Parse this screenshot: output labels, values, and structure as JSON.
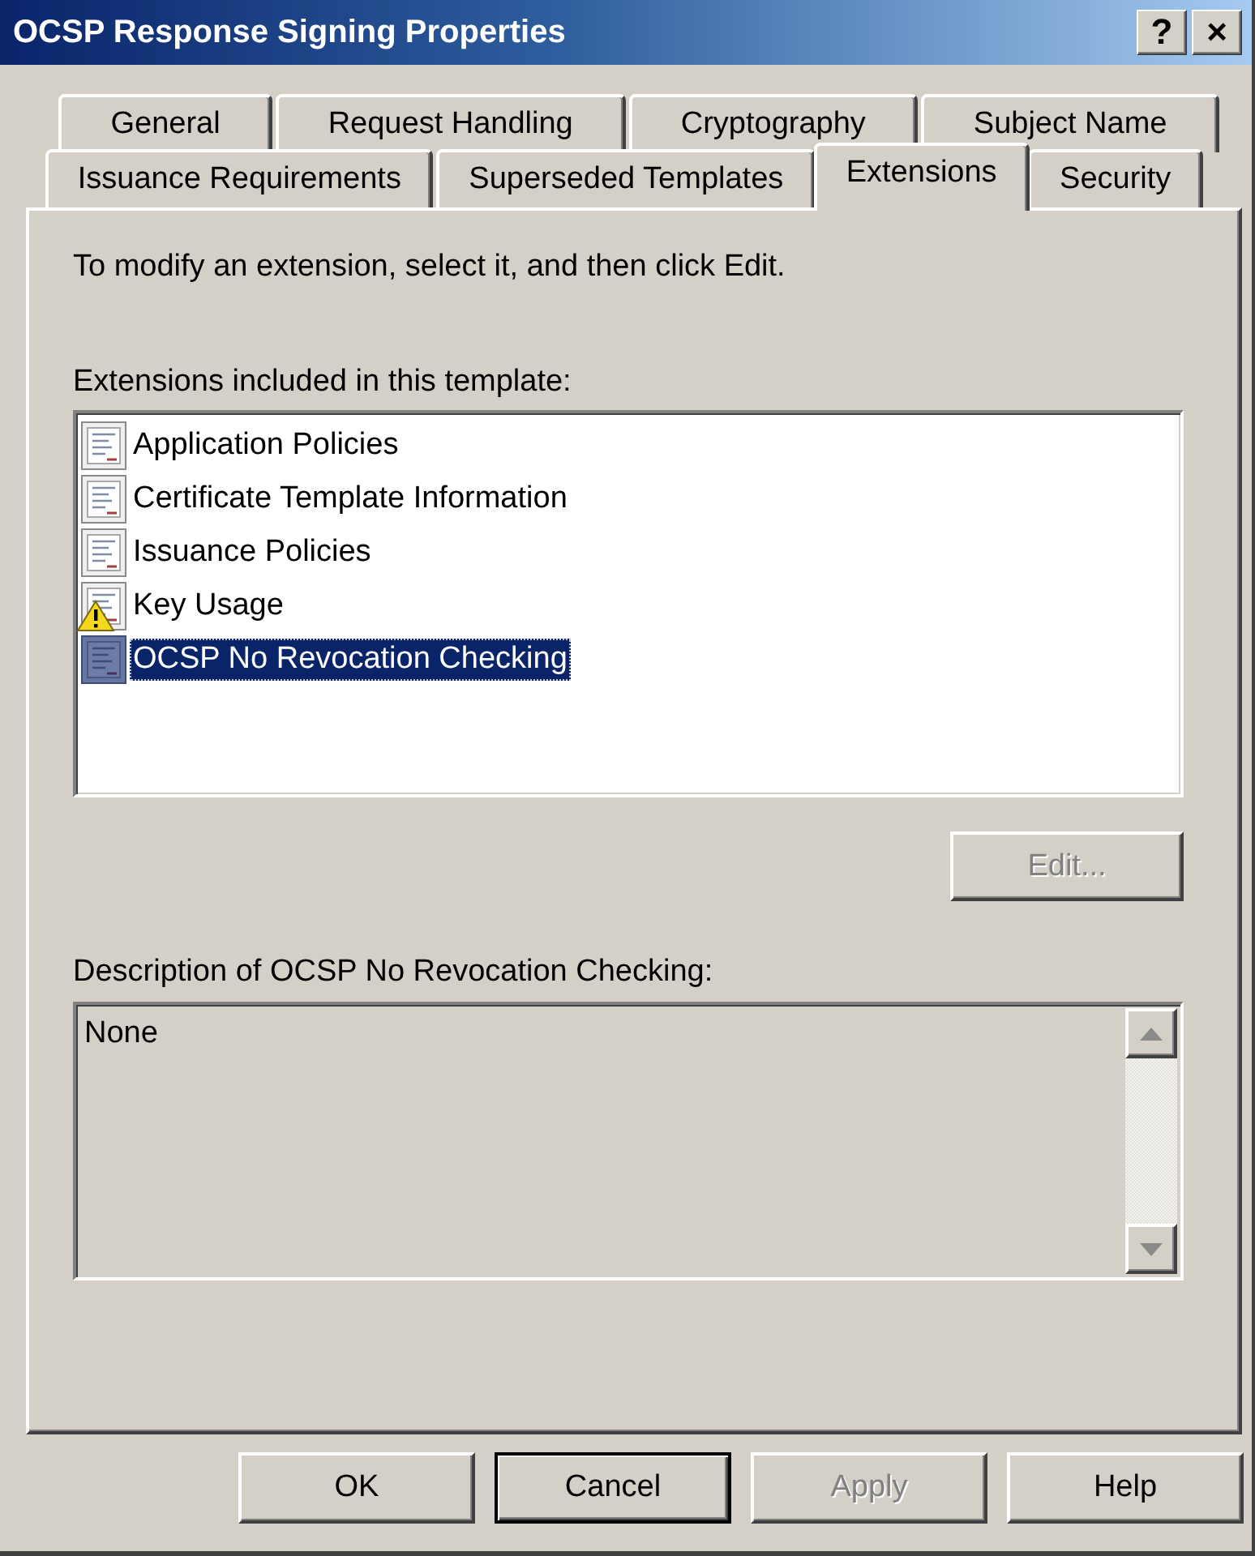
{
  "window": {
    "title": "OCSP Response Signing Properties",
    "title_buttons": [
      "?",
      "×"
    ]
  },
  "tab_rows": [
    {
      "tabs": [
        {
          "label": "General",
          "selected": false
        },
        {
          "label": "Request Handling",
          "selected": false
        },
        {
          "label": "Cryptography",
          "selected": false
        },
        {
          "label": "Subject Name",
          "selected": false
        }
      ]
    },
    {
      "tabs": [
        {
          "label": "Issuance Requirements",
          "selected": false
        },
        {
          "label": "Superseded Templates",
          "selected": false
        },
        {
          "label": "Extensions",
          "selected": true
        },
        {
          "label": "Security",
          "selected": false
        }
      ]
    }
  ],
  "instruction": "To modify an extension, select it, and then click Edit.",
  "extensions": {
    "label": "Extensions included in this template:",
    "items": [
      {
        "name": "Application Policies",
        "warning": false,
        "selected": false
      },
      {
        "name": "Certificate Template Information",
        "warning": false,
        "selected": false
      },
      {
        "name": "Issuance Policies",
        "warning": false,
        "selected": false
      },
      {
        "name": "Key Usage",
        "warning": true,
        "selected": false
      },
      {
        "name": "OCSP No Revocation Checking",
        "warning": false,
        "selected": true
      }
    ]
  },
  "edit_button": {
    "label": "Edit...",
    "disabled": true
  },
  "description": {
    "label": "Description of OCSP No Revocation Checking:",
    "value": "None",
    "read_only": true
  },
  "buttons": [
    {
      "label": "OK",
      "default": false,
      "disabled": false
    },
    {
      "label": "Cancel",
      "default": true,
      "disabled": false
    },
    {
      "label": "Apply",
      "default": false,
      "disabled": true
    },
    {
      "label": "Help",
      "default": false,
      "disabled": false
    }
  ]
}
